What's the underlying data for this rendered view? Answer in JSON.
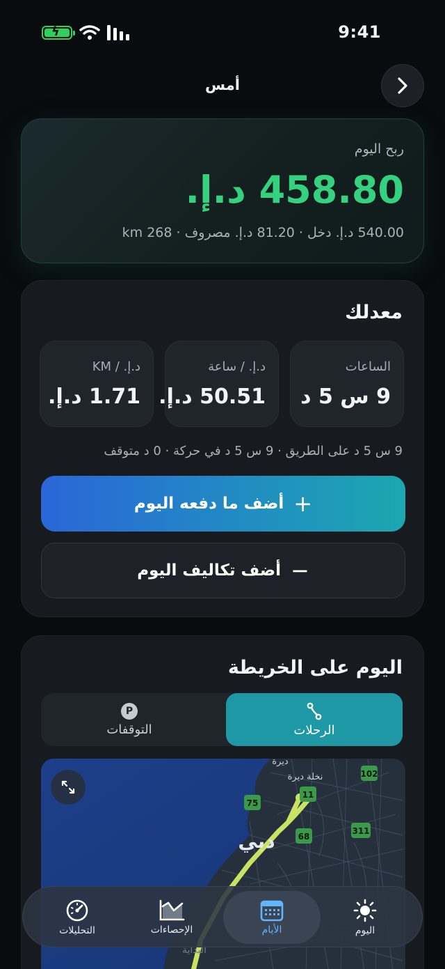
{
  "status_bar": {
    "time": "9:41",
    "icons": [
      "battery-charging-icon",
      "wifi-icon",
      "cellular-signal-icon"
    ],
    "battery_color": "#2fd05c"
  },
  "header": {
    "title": "أمس",
    "nav_icon": "chevron-right-icon"
  },
  "profit_card": {
    "label": "ربح اليوم",
    "value": "458.80 د.إ.",
    "summary": "540.00 د.إ. دخل · 81.20 د.إ. مصروف · 268 km",
    "value_color": "#34d27f"
  },
  "averages": {
    "title": "معدلك",
    "metrics": [
      {
        "label": "الساعات",
        "value": "9 س 5 د"
      },
      {
        "label": "د.إ. / ساعة",
        "value": "50.51 د.إ."
      },
      {
        "label": "د.إ. / KM",
        "value": "1.71 د.إ."
      }
    ],
    "breakdown": "9 س 5 د على الطريق · 9 س 5 د في حركة · 0 د متوقف",
    "add_income_label": "أضف ما دفعه اليوم",
    "add_income_sign": "+",
    "add_expense_label": "أضف تكاليف اليوم",
    "add_expense_sign": "−"
  },
  "map_section": {
    "title": "اليوم على الخريطة",
    "tabs": [
      {
        "label": "الرحلات",
        "icon": "route-icon",
        "selected": true
      },
      {
        "label": "التوقفات",
        "icon": "parking-icon",
        "badge": "P",
        "selected": false
      }
    ],
    "map_labels": {
      "deira": "ديرة",
      "deira_palm": "نخلة ديرة",
      "dubai": "دبي",
      "start": "البداية"
    },
    "map_shields": [
      "102",
      "11",
      "75",
      "68",
      "311"
    ],
    "route_color": "#c9e264",
    "expand_icon": "expand-icon"
  },
  "tab_bar": {
    "tabs": [
      {
        "label": "اليوم",
        "icon": "sun-icon"
      },
      {
        "label": "الأيام",
        "icon": "calendar-icon",
        "selected": true
      },
      {
        "label": "الإحصاءات",
        "icon": "chart-icon"
      },
      {
        "label": "التحليلات",
        "icon": "gauge-icon"
      }
    ],
    "active_color": "#62b6ff"
  }
}
